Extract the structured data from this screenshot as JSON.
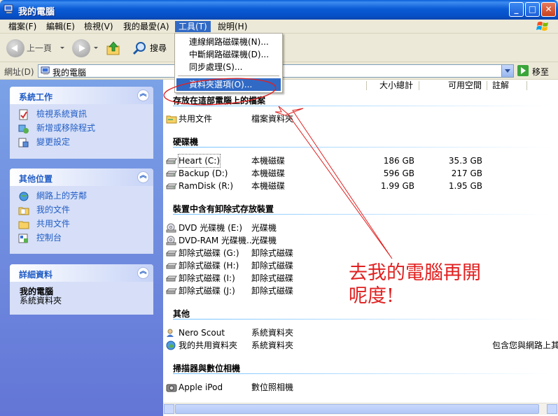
{
  "window": {
    "title": "我的電腦"
  },
  "menubar": {
    "items": [
      "檔案(F)",
      "編輯(E)",
      "檢視(V)",
      "我的最愛(A)",
      "工具(T)",
      "說明(H)"
    ]
  },
  "toolbar": {
    "back_label": "上一頁",
    "search_label": "搜尋"
  },
  "address": {
    "label": "網址(D)",
    "value": "我的電腦",
    "go_label": "移至"
  },
  "tools_menu": {
    "items": [
      "連線網路磁碟機(N)...",
      "中斷網路磁碟機(D)...",
      "同步處理(S)...",
      "資料夾選項(O)..."
    ],
    "selected": "資料夾選項(O)..."
  },
  "left_panes": {
    "system_tasks": {
      "title": "系統工作",
      "items": [
        "檢視系統資訊",
        "新增或移除程式",
        "變更設定"
      ]
    },
    "other_places": {
      "title": "其他位置",
      "items": [
        "網路上的芳鄰",
        "我的文件",
        "共用文件",
        "控制台"
      ]
    },
    "details": {
      "title": "詳細資料",
      "name": "我的電腦",
      "type": "系統資料夾"
    }
  },
  "columns": {
    "size": "大小總計",
    "free": "可用空間",
    "comment": "註解"
  },
  "sections": {
    "stored": {
      "title": "存放在這部電腦上的檔案",
      "rows": [
        {
          "name": "共用文件",
          "type": "檔案資料夾"
        }
      ]
    },
    "hard_disks": {
      "title": "硬碟機",
      "rows": [
        {
          "name": "Heart (C:)",
          "type": "本機磁碟",
          "size": "186 GB",
          "free": "35.3 GB"
        },
        {
          "name": "Backup (D:)",
          "type": "本機磁碟",
          "size": "596 GB",
          "free": "217 GB"
        },
        {
          "name": "RamDisk (R:)",
          "type": "本機磁碟",
          "size": "1.99 GB",
          "free": "1.95 GB"
        }
      ]
    },
    "removable": {
      "title": "裝置中含有卸除式存放裝置",
      "rows": [
        {
          "name": "DVD 光碟機 (E:)",
          "type": "光碟機"
        },
        {
          "name": "DVD-RAM 光碟機...",
          "type": "光碟機"
        },
        {
          "name": "卸除式磁碟 (G:)",
          "type": "卸除式磁碟"
        },
        {
          "name": "卸除式磁碟 (H:)",
          "type": "卸除式磁碟"
        },
        {
          "name": "卸除式磁碟 (I:)",
          "type": "卸除式磁碟"
        },
        {
          "name": "卸除式磁碟 (J:)",
          "type": "卸除式磁碟"
        }
      ]
    },
    "other": {
      "title": "其他",
      "rows": [
        {
          "name": "Nero Scout",
          "type": "系統資料夾",
          "comment": ""
        },
        {
          "name": "我的共用資料夾",
          "type": "系統資料夾",
          "comment": "包含您與網路上其"
        }
      ]
    },
    "scanners": {
      "title": "掃描器與數位相機",
      "rows": [
        {
          "name": "Apple iPod",
          "type": "數位照相機"
        }
      ]
    }
  },
  "annotation": {
    "line1": "去我的電腦再開",
    "line2": "呢度!"
  }
}
